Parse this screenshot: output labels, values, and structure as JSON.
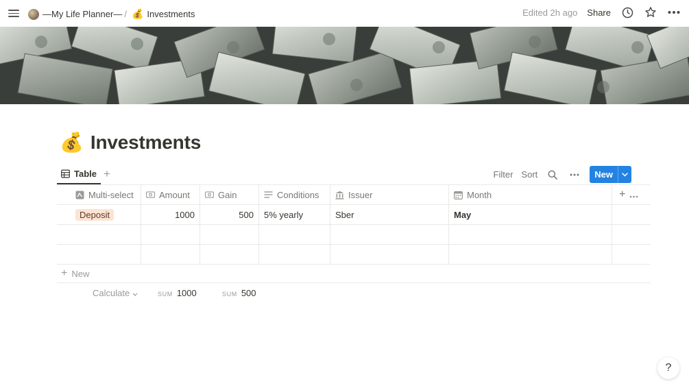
{
  "topbar": {
    "breadcrumb": [
      {
        "label": "—My Life Planner—",
        "icon": "planner-icon"
      },
      {
        "label": "Investments",
        "icon": "money-bag-icon"
      }
    ],
    "separator": "/",
    "edited": "Edited 2h ago",
    "share": "Share"
  },
  "page": {
    "title": "Investments",
    "icon": "💰"
  },
  "views": {
    "tab_label": "Table",
    "tools": {
      "filter": "Filter",
      "sort": "Sort"
    },
    "new_label": "New",
    "accent": "#2383e2"
  },
  "table": {
    "columns": [
      "Multi-select",
      "Amount",
      "Gain",
      "Conditions",
      "Issuer",
      "Month"
    ],
    "rows": [
      {
        "multiselect": "Deposit",
        "amount": "1000",
        "gain": "500",
        "conditions": "5% yearly",
        "issuer": "Sber",
        "month": "May"
      }
    ],
    "new_row_label": "New",
    "calculate_label": "Calculate",
    "sum_label": "SUM",
    "sums": {
      "amount": "1000",
      "gain": "500"
    },
    "tag_color": "#fbe4d3"
  },
  "help_label": "?"
}
